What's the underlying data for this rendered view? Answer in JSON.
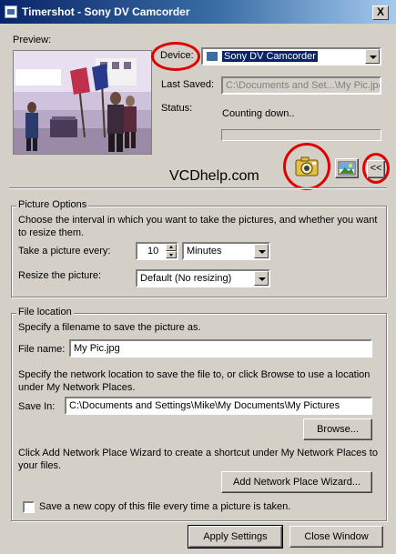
{
  "window": {
    "title": "Timershot - Sony DV Camcorder",
    "close_glyph": "X"
  },
  "preview": {
    "label": "Preview:",
    "watermark": "VCDhelp.com"
  },
  "device": {
    "label": "Device:",
    "value": "Sony DV Camcorder"
  },
  "last_saved": {
    "label": "Last Saved:",
    "value": "C:\\Documents and Set...\\My Pic.jpg"
  },
  "status": {
    "label": "Status:",
    "value": "Counting down.."
  },
  "toolbar": {
    "camera_icon": "camera-icon",
    "picture_icon": "picture-icon",
    "collapse_label": "<<"
  },
  "picture_options": {
    "title": "Picture Options",
    "description": "Choose the interval in which you want to take the pictures, and whether you want to resize them.",
    "interval_label": "Take a picture every:",
    "interval_value": "10",
    "interval_unit": "Minutes",
    "resize_label": "Resize the picture:",
    "resize_value": "Default (No resizing)"
  },
  "file_location": {
    "title": "File location",
    "filename_desc": "Specify a filename to save the picture as.",
    "filename_label": "File name:",
    "filename_value": "My Pic.jpg",
    "network_desc": "Specify the network location to save the file to, or click Browse to use a location under My Network Places.",
    "save_in_label": "Save In:",
    "save_in_value": "C:\\Documents and Settings\\Mike\\My Documents\\My Pictures",
    "browse_label": "Browse...",
    "wizard_desc": "Click Add Network Place Wizard to create a shortcut under My Network Places to your files.",
    "wizard_label": "Add Network Place Wizard...",
    "save_copy_label": "Save a new copy of this file every time a picture is taken.",
    "save_copy_checked": false
  },
  "footer": {
    "apply_label": "Apply Settings",
    "close_label": "Close Window"
  },
  "colors": {
    "titlebar": "#0a246a",
    "face": "#d4d0c8",
    "highlight_circle": "#e00000",
    "selection": "#0a246a"
  }
}
